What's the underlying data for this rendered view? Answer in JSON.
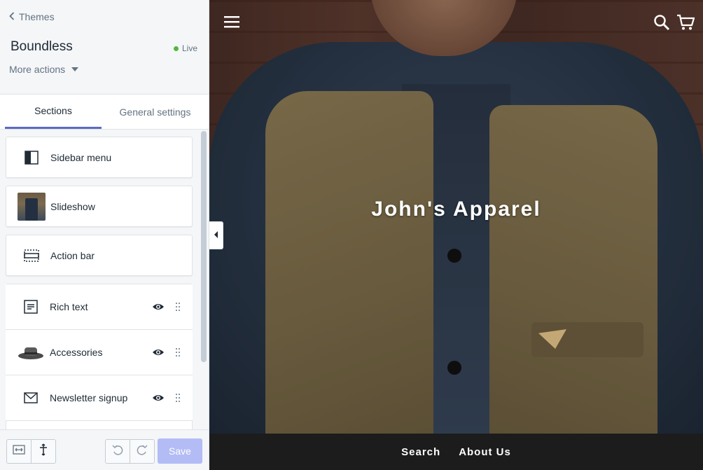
{
  "sidebar": {
    "back_label": "Themes",
    "theme_name": "Boundless",
    "status": "Live",
    "more_actions": "More actions",
    "tabs": [
      {
        "label": "Sections"
      },
      {
        "label": "General settings"
      }
    ],
    "sections": [
      {
        "label": "Sidebar menu",
        "icon": "sidebar-layout-icon"
      },
      {
        "label": "Slideshow",
        "icon": "slideshow-thumbnail"
      },
      {
        "label": "Action bar",
        "icon": "action-bar-icon"
      },
      {
        "label": "Rich text",
        "icon": "rich-text-icon"
      },
      {
        "label": "Accessories",
        "icon": "accessories-thumbnail"
      },
      {
        "label": "Newsletter signup",
        "icon": "envelope-icon"
      }
    ],
    "save_label": "Save"
  },
  "preview": {
    "hero_title": "John's Apparel",
    "footer_links": [
      "Search",
      "About Us"
    ]
  },
  "colors": {
    "accent": "#5c6ac4",
    "live": "#50b83c",
    "save_disabled": "#b3bcf5",
    "footer_bg": "#1c1c1c"
  }
}
